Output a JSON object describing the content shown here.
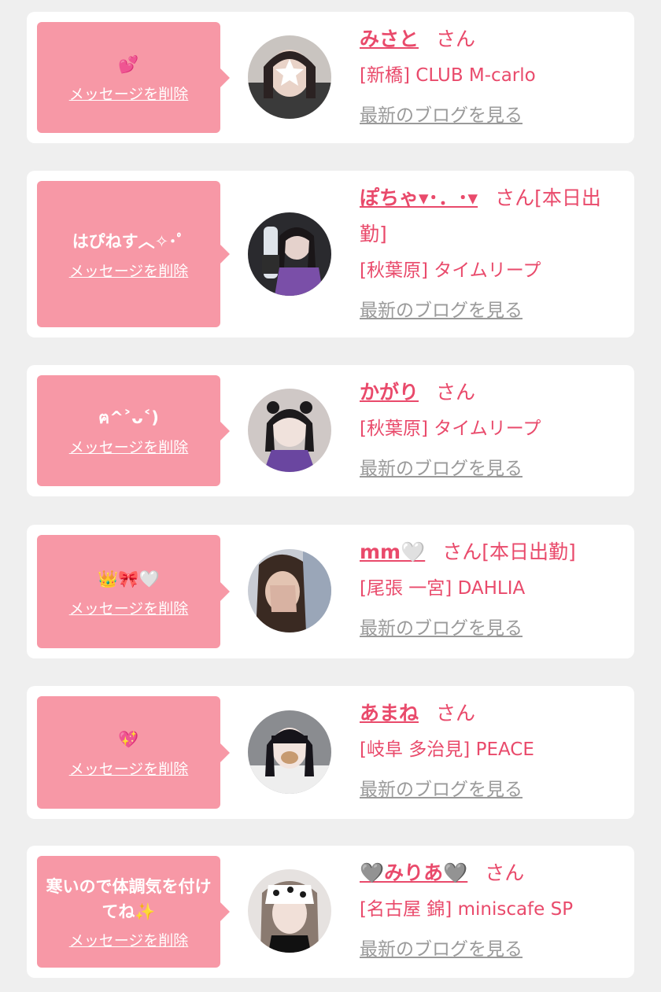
{
  "colors": {
    "accent": "#e94a6b",
    "bubble": "#f798a6",
    "link_gray": "#9a9a9a",
    "background": "#efefef"
  },
  "items": [
    {
      "message": "💕",
      "delete_label": "メッセージを削除",
      "name": "みさと",
      "suffix": "さん",
      "shop": "[新橋] CLUB M-carlo",
      "blog_label": "最新のブログを見る"
    },
    {
      "message": "はぴねす︿✧･ﾟ",
      "delete_label": "メッセージを削除",
      "name": "ぽちゃ▾･．･▾",
      "suffix": "さん[本日出勤]",
      "shop": "[秋葉原] タイムリープ",
      "blog_label": "最新のブログを見る"
    },
    {
      "message": "ฅ^˃ᴗ˂)",
      "delete_label": "メッセージを削除",
      "name": "かがり",
      "suffix": "さん",
      "shop": "[秋葉原] タイムリープ",
      "blog_label": "最新のブログを見る"
    },
    {
      "message": "👑🎀🤍",
      "delete_label": "メッセージを削除",
      "name": "mm🤍",
      "suffix": "さん[本日出勤]",
      "shop": "[尾張 一宮] DAHLIA",
      "blog_label": "最新のブログを見る"
    },
    {
      "message": "💖",
      "delete_label": "メッセージを削除",
      "name": "あまね",
      "suffix": "さん",
      "shop": "[岐阜 多治見] PEACE",
      "blog_label": "最新のブログを見る"
    },
    {
      "message": "寒いので体調気を付けてね✨",
      "delete_label": "メッセージを削除",
      "name": "🩶みりあ🩶",
      "suffix": "さん",
      "shop": "[名古屋 錦] miniscafe SP",
      "blog_label": "最新のブログを見る"
    }
  ]
}
